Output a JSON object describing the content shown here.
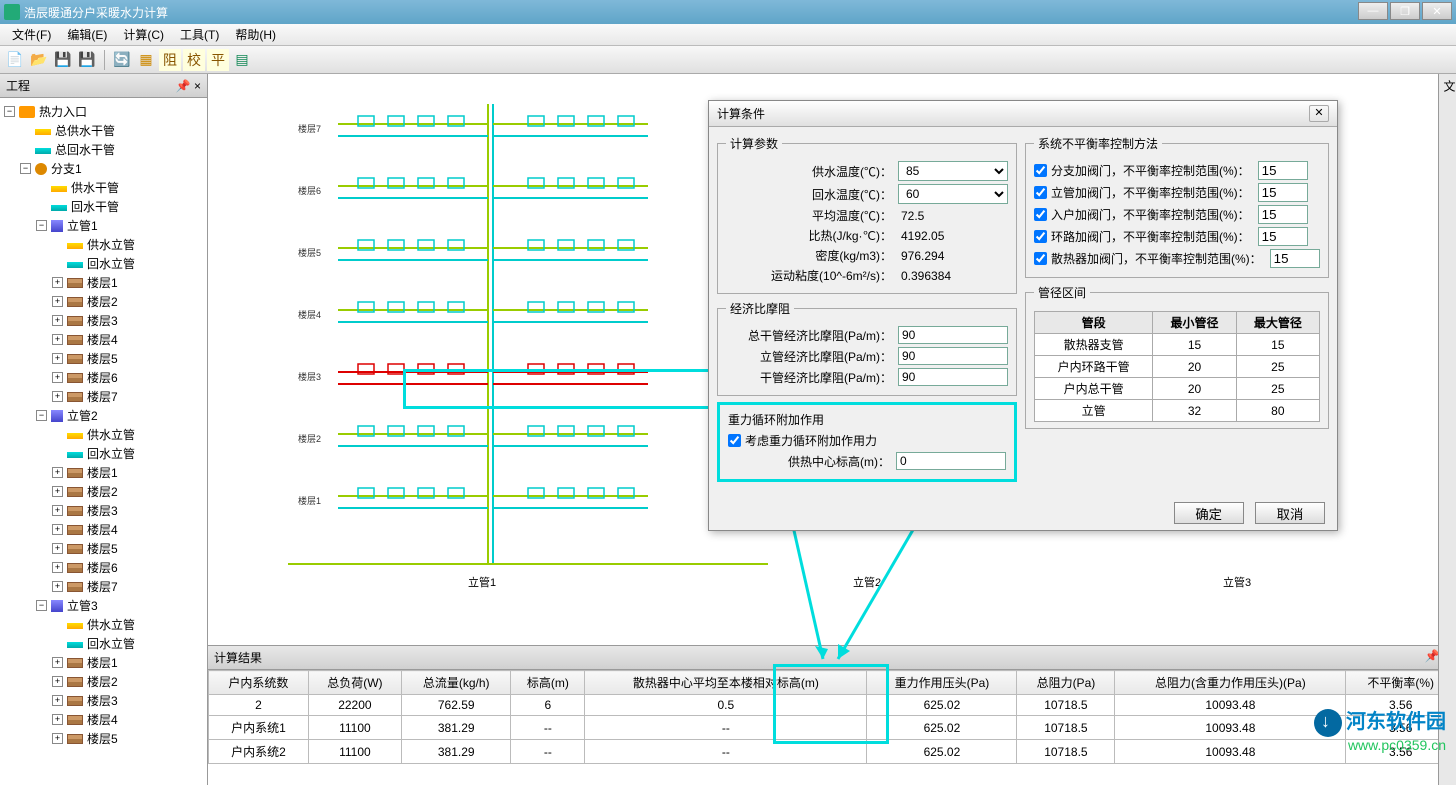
{
  "window": {
    "title": "浩辰暖通分户采暖水力计算",
    "minimize": "—",
    "maximize": "❐",
    "close": "✕"
  },
  "menu": {
    "file": "文件(F)",
    "edit": "编辑(E)",
    "calc": "计算(C)",
    "tool": "工具(T)",
    "help": "帮助(H)"
  },
  "panel": {
    "project": "工程",
    "pin": "📌",
    "close": "×"
  },
  "tree": {
    "root": "热力入口",
    "supplyMain": "总供水干管",
    "returnMain": "总回水干管",
    "branch1": "分支1",
    "supplyBranch": "供水干管",
    "returnBranch": "回水干管",
    "riser1": "立管1",
    "riser2": "立管2",
    "riser3": "立管3",
    "supplyRiser": "供水立管",
    "returnRiser": "回水立管",
    "floor1": "楼层1",
    "floor2": "楼层2",
    "floor3": "楼层3",
    "floor4": "楼层4",
    "floor5": "楼层5",
    "floor6": "楼层6",
    "floor7": "楼层7"
  },
  "dialog": {
    "title": "计算条件",
    "close": "✕",
    "params": {
      "legend": "计算参数",
      "supplyTemp": "供水温度(℃)：",
      "supplyTempVal": "85",
      "returnTemp": "回水温度(℃)：",
      "returnTempVal": "60",
      "avgTemp": "平均温度(℃)：",
      "avgTempVal": "72.5",
      "specHeat": "比热(J/kg·℃)：",
      "specHeatVal": "4192.05",
      "density": "密度(kg/m3)：",
      "densityVal": "976.294",
      "viscosity": "运动粘度(10^-6m²/s)：",
      "viscosityVal": "0.396384"
    },
    "friction": {
      "legend": "经济比摩阻",
      "main": "总干管经济比摩阻(Pa/m)：",
      "mainVal": "90",
      "riser": "立管经济比摩阻(Pa/m)：",
      "riserVal": "90",
      "branch": "干管经济比摩阻(Pa/m)：",
      "branchVal": "90"
    },
    "gravity": {
      "legend": "重力循环附加作用",
      "consider": "考虑重力循环附加作用力",
      "centerHeight": "供热中心标高(m)：",
      "centerHeightVal": "0"
    },
    "imbalance": {
      "legend": "系统不平衡率控制方法",
      "branch": "分支加阀门，不平衡率控制范围(%)：",
      "branchVal": "15",
      "riser": "立管加阀门，不平衡率控制范围(%)：",
      "riserVal": "15",
      "entry": "入户加阀门，不平衡率控制范围(%)：",
      "entryVal": "15",
      "loop": "环路加阀门，不平衡率控制范围(%)：",
      "loopVal": "15",
      "radiator": "散热器加阀门，不平衡率控制范围(%)：",
      "radiatorVal": "15"
    },
    "diameter": {
      "legend": "管径区间",
      "col1": "管段",
      "col2": "最小管径",
      "col3": "最大管径",
      "rows": [
        {
          "name": "散热器支管",
          "min": "15",
          "max": "15"
        },
        {
          "name": "户内环路干管",
          "min": "20",
          "max": "25"
        },
        {
          "name": "户内总干管",
          "min": "20",
          "max": "25"
        },
        {
          "name": "立管",
          "min": "32",
          "max": "80"
        }
      ]
    },
    "ok": "确定",
    "cancel": "取消"
  },
  "results": {
    "title": "计算结果",
    "headers": {
      "sys": "户内系统数",
      "load": "总负荷(W)",
      "flow": "总流量(kg/h)",
      "elev": "标高(m)",
      "radElev": "散热器中心平均至本楼相对标高(m)",
      "gravHead": "重力作用压头(Pa)",
      "resist": "总阻力(Pa)",
      "resistGrav": "总阻力(含重力作用压头)(Pa)",
      "imbal": "不平衡率(%)"
    },
    "rows": [
      {
        "sys": "2",
        "load": "22200",
        "flow": "762.59",
        "elev": "6",
        "radElev": "0.5",
        "gravHead": "625.02",
        "resist": "10718.5",
        "resistGrav": "10093.48",
        "imbal": "3.56"
      },
      {
        "sys": "户内系统1",
        "load": "11100",
        "flow": "381.29",
        "elev": "--",
        "radElev": "--",
        "gravHead": "625.02",
        "resist": "10718.5",
        "resistGrav": "10093.48",
        "imbal": "3.56"
      },
      {
        "sys": "户内系统2",
        "load": "11100",
        "flow": "381.29",
        "elev": "--",
        "radElev": "--",
        "gravHead": "625.02",
        "resist": "10718.5",
        "resistGrav": "10093.48",
        "imbal": "3.56"
      }
    ]
  },
  "canvas": {
    "label1": "立管1",
    "label2": "立管2",
    "label3": "立管3"
  },
  "watermark": {
    "name": "河东软件园",
    "url": "www.pc0359.cn"
  },
  "rightTab": "文"
}
